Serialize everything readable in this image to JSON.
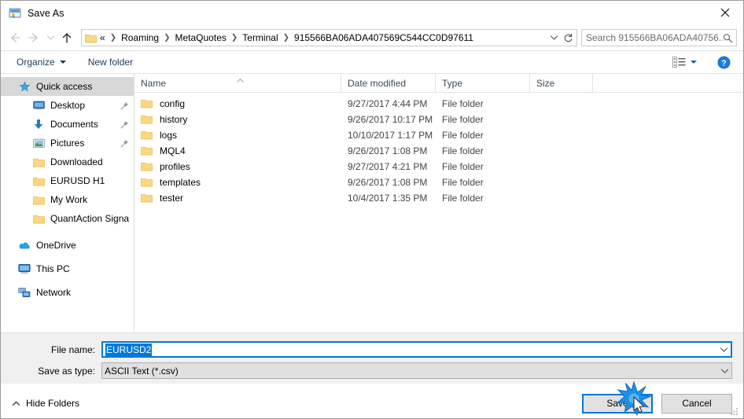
{
  "window": {
    "title": "Save As",
    "icon": "save-as-icon",
    "close_icon": "close-icon"
  },
  "nav": {
    "back_icon": "back-arrow-icon",
    "forward_icon": "forward-arrow-icon",
    "recent_icon": "recent-locations-chevron-icon",
    "up_icon": "up-arrow-icon",
    "address": {
      "folder_icon": "folder-icon",
      "overflow": "«",
      "crumbs": [
        "Roaming",
        "MetaQuotes",
        "Terminal",
        "915566BA06ADA407569C544CC0D97611"
      ],
      "separator": "❯",
      "dropdown_icon": "chevron-down-icon",
      "refresh_icon": "refresh-icon"
    },
    "search": {
      "placeholder": "Search 915566BA06ADA40756...",
      "icon": "search-icon"
    }
  },
  "toolbar": {
    "organize_label": "Organize",
    "new_folder_label": "New folder",
    "view_icon": "view-layout-icon",
    "view_caret_icon": "chevron-down-icon",
    "help_icon": "help-icon",
    "help_glyph": "?"
  },
  "sidebar": {
    "items": [
      {
        "label": "Quick access",
        "icon": "star-icon",
        "level": 0,
        "selected": true,
        "pinned": false
      },
      {
        "label": "Desktop",
        "icon": "desktop-icon",
        "level": 1,
        "selected": false,
        "pinned": true
      },
      {
        "label": "Documents",
        "icon": "documents-icon",
        "level": 1,
        "selected": false,
        "pinned": true
      },
      {
        "label": "Pictures",
        "icon": "pictures-icon",
        "level": 1,
        "selected": false,
        "pinned": true
      },
      {
        "label": "Downloaded",
        "icon": "folder-icon",
        "level": 1,
        "selected": false,
        "pinned": false
      },
      {
        "label": "EURUSD H1",
        "icon": "folder-icon",
        "level": 1,
        "selected": false,
        "pinned": false
      },
      {
        "label": "My Work",
        "icon": "folder-icon",
        "level": 1,
        "selected": false,
        "pinned": false
      },
      {
        "label": "QuantAction Signal",
        "icon": "folder-icon",
        "level": 1,
        "selected": false,
        "pinned": false
      },
      {
        "label": "OneDrive",
        "icon": "onedrive-icon",
        "level": 0,
        "selected": false,
        "pinned": false
      },
      {
        "label": "This PC",
        "icon": "this-pc-icon",
        "level": 0,
        "selected": false,
        "pinned": false
      },
      {
        "label": "Network",
        "icon": "network-icon",
        "level": 0,
        "selected": false,
        "pinned": false
      }
    ]
  },
  "filelist": {
    "columns": [
      "Name",
      "Date modified",
      "Type",
      "Size"
    ],
    "sort_column": "Name",
    "sort_direction": "ascending",
    "rows": [
      {
        "name": "config",
        "date": "9/27/2017 4:44 PM",
        "type": "File folder",
        "size": ""
      },
      {
        "name": "history",
        "date": "9/26/2017 10:17 PM",
        "type": "File folder",
        "size": ""
      },
      {
        "name": "logs",
        "date": "10/10/2017 1:17 PM",
        "type": "File folder",
        "size": ""
      },
      {
        "name": "MQL4",
        "date": "9/26/2017 1:08 PM",
        "type": "File folder",
        "size": ""
      },
      {
        "name": "profiles",
        "date": "9/27/2017 4:21 PM",
        "type": "File folder",
        "size": ""
      },
      {
        "name": "templates",
        "date": "9/26/2017 1:08 PM",
        "type": "File folder",
        "size": ""
      },
      {
        "name": "tester",
        "date": "10/4/2017 1:35 PM",
        "type": "File folder",
        "size": ""
      }
    ]
  },
  "form": {
    "filename_label": "File name:",
    "filename_value": "EURUSD2",
    "filetype_label": "Save as type:",
    "filetype_value": "ASCII Text (*.csv)",
    "dropdown_icon": "chevron-down-icon"
  },
  "footer": {
    "hide_folders_label": "Hide Folders",
    "hide_folders_icon": "chevron-up-icon",
    "save_label": "Save",
    "cancel_label": "Cancel",
    "resize_grip_icon": "resize-grip-icon",
    "click_indicator_icon": "click-burst-icon",
    "cursor_icon": "mouse-pointer-icon"
  },
  "colors": {
    "accent": "#0078d7",
    "folder": "#fcd77f",
    "selection": "#d8d8d8",
    "chrome": "#f0f0f0"
  }
}
